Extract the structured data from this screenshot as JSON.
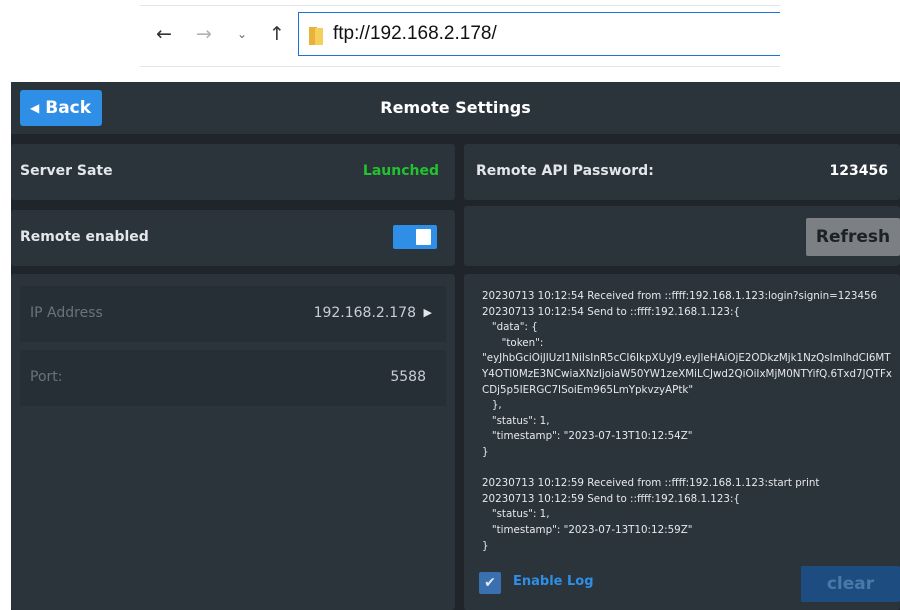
{
  "explorer": {
    "back_glyph": "←",
    "forward_glyph": "→",
    "recent_glyph": "⌄",
    "up_glyph": "↑",
    "address": "ftp://192.168.2.178/"
  },
  "header": {
    "back_label": "Back",
    "title": "Remote Settings"
  },
  "server": {
    "label": "Server Sate",
    "status": "Launched"
  },
  "remote": {
    "label": "Remote enabled",
    "enabled": true
  },
  "network": {
    "ip_label": "IP Address",
    "ip_value": "192.168.2.178",
    "port_label": "Port:",
    "port_value": "5588"
  },
  "api": {
    "password_label": "Remote API Password:",
    "password_value": "123456",
    "refresh_label": "Refresh"
  },
  "log": {
    "text": "20230713 10:12:54 Received from ::ffff:192.168.1.123:login?signin=123456\n20230713 10:12:54 Send to ::ffff:192.168.1.123:{\n   \"data\": {\n      \"token\":\n\"eyJhbGciOiJIUzI1NiIsInR5cCI6IkpXUyJ9.eyJleHAiOjE2ODkzMjk1NzQsImlhdCI6MTY4OTI0MzE3NCwiaXNzIjoiaW50YW1zeXMiLCJwd2QiOiIxMjM0NTYifQ.6Txd7JQTFxCDj5p5IERGC7ISoiEm965LmYpkvzyAPtk\"\n   },\n   \"status\": 1,\n   \"timestamp\": \"2023-07-13T10:12:54Z\"\n}\n\n20230713 10:12:59 Received from ::ffff:192.168.1.123:start print\n20230713 10:12:59 Send to ::ffff:192.168.1.123:{\n   \"status\": 1,\n   \"timestamp\": \"2023-07-13T10:12:59Z\"\n}",
    "enable_label": "Enable Log",
    "enable_checked": true,
    "clear_label": "clear"
  },
  "colors": {
    "accent": "#2f8fe6",
    "status_ok": "#22c32e",
    "background": "#1f252b",
    "panel": "#2b333b"
  }
}
